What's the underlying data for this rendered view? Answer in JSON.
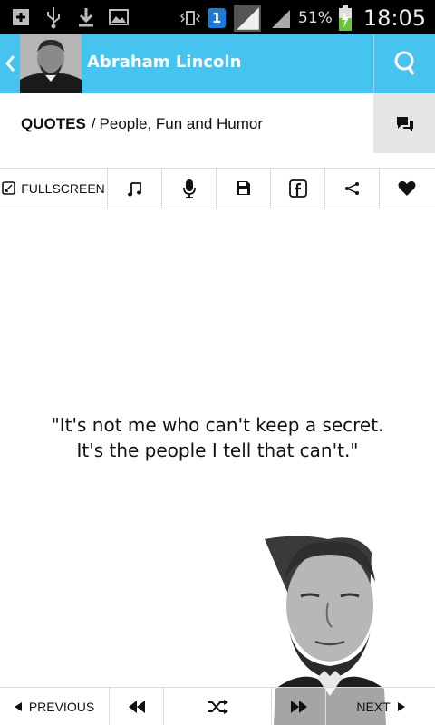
{
  "status_bar": {
    "battery": "51%",
    "time": "18:05",
    "sim": "1",
    "icons": [
      "add-icon",
      "usb-icon",
      "download-icon",
      "image-icon",
      "vibrate-icon",
      "signal-icon",
      "battery-icon"
    ]
  },
  "header": {
    "title": "Abraham Lincoln",
    "icons": [
      "back-chevron-icon",
      "search-icon"
    ]
  },
  "breadcrumb": {
    "section": "QUOTES",
    "separator": "/",
    "category": "People, Fun and Humor"
  },
  "toolbar": {
    "fullscreen_label": "FULLSCREEN",
    "icons": [
      "fullscreen-icon",
      "music-icon",
      "microphone-icon",
      "save-icon",
      "facebook-icon",
      "share-icon",
      "heart-icon"
    ]
  },
  "quote": {
    "line1": "\"It's not me who can't keep a secret.",
    "line2": "It's the people I tell that can't.\""
  },
  "bottom_nav": {
    "previous_label": "PREVIOUS",
    "next_label": "NEXT",
    "icons": [
      "previous-arrow-icon",
      "rewind-icon",
      "shuffle-icon",
      "fast-forward-icon",
      "next-arrow-icon"
    ]
  },
  "colors": {
    "header_bg": "#46c3ef",
    "status_bg": "#000000",
    "comment_bg": "#e6e6e6",
    "divider": "#dcdcdc"
  }
}
